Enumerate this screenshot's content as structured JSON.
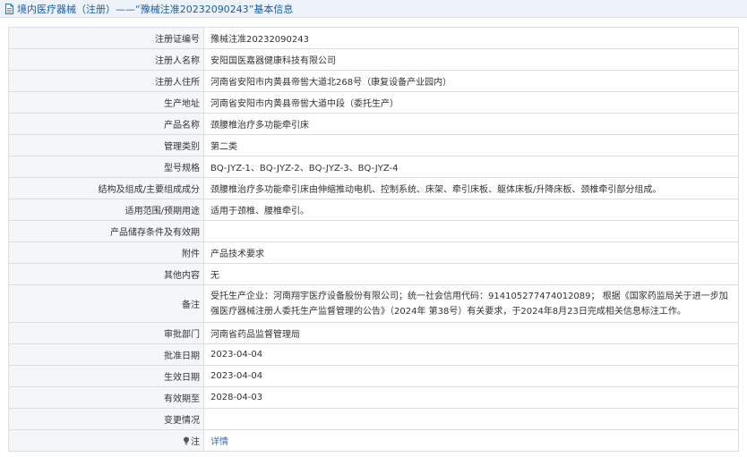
{
  "header": {
    "title": "境内医疗器械（注册）——“豫械注准20232090243”基本信息"
  },
  "rows": [
    {
      "label": "注册证编号",
      "value": "豫械注准20232090243"
    },
    {
      "label": "注册人名称",
      "value": "安阳国医嘉器健康科技有限公司"
    },
    {
      "label": "注册人住所",
      "value": "河南省安阳市内黄县帝喾大道北268号（康复设备产业园内）"
    },
    {
      "label": "生产地址",
      "value": "河南省安阳市内黄县帝喾大道中段（委托生产）"
    },
    {
      "label": "产品名称",
      "value": "颈腰椎治疗多功能牵引床"
    },
    {
      "label": "管理类别",
      "value": "第二类"
    },
    {
      "label": "型号规格",
      "value": "BQ-JYZ-1、BQ-JYZ-2、BQ-JYZ-3、BQ-JYZ-4"
    },
    {
      "label": "结构及组成/主要组成成分",
      "value": "颈腰椎治疗多功能牵引床由伸缩推动电机、控制系统、床架、牵引床板、躯体床板/升降床板、颈椎牵引部分组成。"
    },
    {
      "label": "适用范围/预期用途",
      "value": "适用于颈椎、腰椎牵引。"
    },
    {
      "label": "产品储存条件及有效期",
      "value": ""
    },
    {
      "label": "附件",
      "value": "产品技术要求"
    },
    {
      "label": "其他内容",
      "value": "无"
    },
    {
      "label": "备注",
      "value": "受托生产企业：河南翔宇医疗设备股份有限公司；统一社会信用代码：914105277474012089； 根据《国家药监局关于进一步加强医疗器械注册人委托生产监督管理的公告》（2024年 第38号）有关要求，于2024年8月23日完成相关信息标注工作。"
    },
    {
      "label": "审批部门",
      "value": "河南省药品监督管理局"
    },
    {
      "label": "批准日期",
      "value": "2023-04-04"
    },
    {
      "label": "生效日期",
      "value": "2023-04-04"
    },
    {
      "label": "有效期至",
      "value": "2028-04-03"
    },
    {
      "label": "变更情况",
      "value": ""
    },
    {
      "label": "注",
      "value": "详情"
    }
  ],
  "colors": {
    "title_text": "#1a5da6",
    "link": "#2f6fc0",
    "label_bg": "#f5f6f8",
    "border": "#dadde1",
    "header_bg": "#eef3f9"
  },
  "icons": {
    "title": "document-icon",
    "note": "lightbulb-icon"
  }
}
